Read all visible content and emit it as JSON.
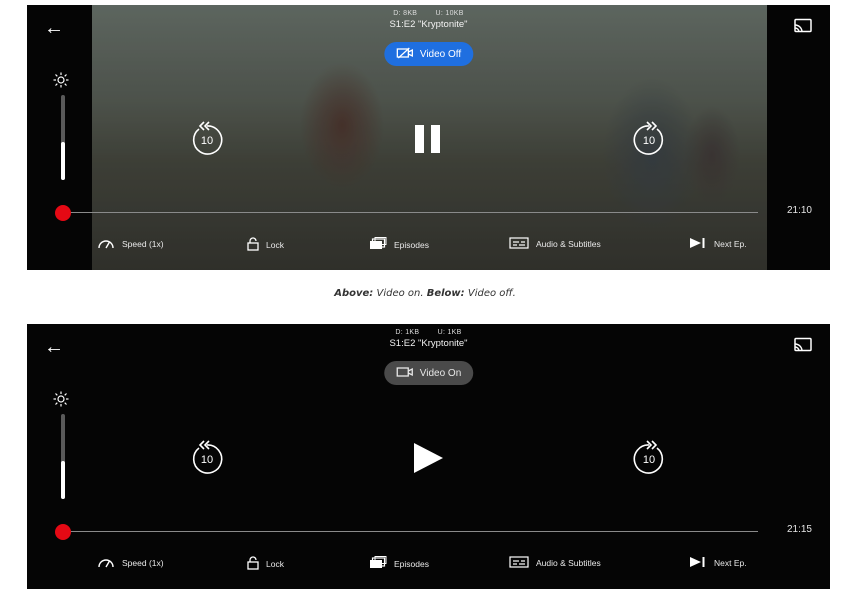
{
  "players": {
    "top": {
      "stats_down": "D: 8KB",
      "stats_up": "U: 10KB",
      "episode_title": "S1:E2 \"Kryptonite\"",
      "video_toggle_label": "Video Off",
      "time_remaining": "21:10",
      "center_state": "pause",
      "brightness_level": 0.45,
      "skip_back_seconds": "10",
      "skip_forward_seconds": "10"
    },
    "bottom": {
      "stats_down": "D: 1KB",
      "stats_up": "U: 1KB",
      "episode_title": "S1:E2 \"Kryptonite\"",
      "video_toggle_label": "Video On",
      "time_remaining": "21:15",
      "center_state": "play",
      "brightness_level": 0.45,
      "skip_back_seconds": "10",
      "skip_forward_seconds": "10"
    }
  },
  "controls": {
    "speed": "Speed (1x)",
    "lock": "Lock",
    "episodes": "Episodes",
    "audio_subtitles": "Audio & Subtitles",
    "next_episode": "Next Ep."
  },
  "caption": {
    "above_bold": "Above:",
    "above_text": " Video on. ",
    "below_bold": "Below:",
    "below_text": " Video off."
  },
  "colors": {
    "accent_blue": "#1f6fe0",
    "scrubber_red": "#e50914",
    "player_bg": "#050505"
  },
  "icons": [
    "back-arrow-icon",
    "cast-icon",
    "sun-icon",
    "rewind-10-icon",
    "forward-10-icon",
    "pause-icon",
    "play-icon",
    "speed-icon",
    "lock-icon",
    "episodes-icon",
    "subtitles-icon",
    "next-episode-icon",
    "video-camera-icon",
    "video-camera-off-icon"
  ]
}
